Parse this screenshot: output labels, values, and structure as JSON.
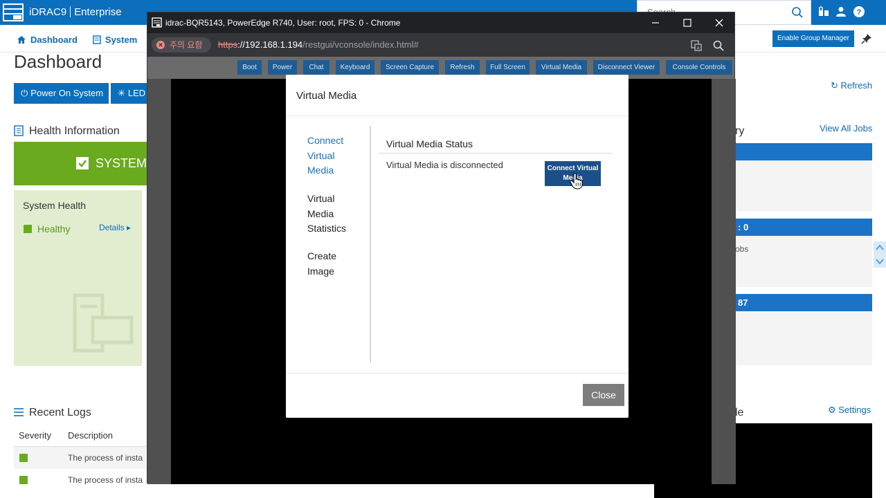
{
  "app": {
    "brand": "iDRAC9",
    "edition": "Enterprise",
    "search_placeholder": "Search",
    "nav": {
      "dashboard": "Dashboard",
      "system": "System"
    },
    "enable_group_manager": "Enable Group Manager",
    "page_title": "Dashboard",
    "power_on_button": "Power On System",
    "led_button": "LED",
    "refresh": "Refresh",
    "health_information": "Health Information",
    "system_banner": "SYSTEM",
    "system_health_label": "System Health",
    "system_health_status": "Healthy",
    "details_link": "Details",
    "view_all_jobs": "View All Jobs",
    "summary_fragment": "ry",
    "jobs_count_fragment": ": 0",
    "jobs_fragment": "obs",
    "count_fragment": "87",
    "settings_link": "Settings",
    "console_fragment": "le",
    "recent_logs": "Recent Logs",
    "logs_columns": [
      "Severity",
      "Description"
    ],
    "logs_rows": [
      "The process of insta",
      "The process of insta"
    ]
  },
  "browser": {
    "window_title": "idrac-BQR5143, PowerEdge R740, User: root, FPS: 0 - Chrome",
    "security_warning": "주의 요함",
    "url_scheme": "https",
    "url_host": "://192.168.1.194",
    "url_path": "/restgui/vconsole/index.html#"
  },
  "console_toolbar": [
    "Boot",
    "Power",
    "Chat",
    "Keyboard",
    "Screen Capture",
    "Refresh",
    "Full Screen",
    "Virtual Media",
    "Disconnect Viewer",
    "Console Controls"
  ],
  "modal": {
    "title": "Virtual Media",
    "nav": [
      {
        "label": "Connect Virtual Media",
        "active": true
      },
      {
        "label": "Virtual Media Statistics",
        "active": false
      },
      {
        "label": "Create Image",
        "active": false
      }
    ],
    "status_heading": "Virtual Media Status",
    "status_text": "Virtual Media is disconnected",
    "connect_button": "Connect Virtual Media",
    "close_button": "Close"
  },
  "colors": {
    "idrac_blue": "#0b6fbe",
    "healthy_green": "#6aaa1e",
    "console_button": "#1e5c96",
    "connect_button": "#1a4f8a"
  }
}
